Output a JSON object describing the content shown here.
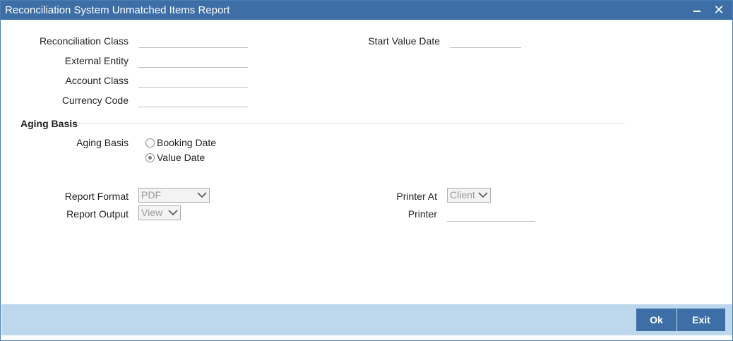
{
  "window": {
    "title": "Reconciliation System Unmatched Items Report"
  },
  "fields": {
    "reconciliation_class": {
      "label": "Reconciliation Class",
      "value": ""
    },
    "external_entity": {
      "label": "External Entity",
      "value": ""
    },
    "account_class": {
      "label": "Account Class",
      "value": ""
    },
    "currency_code": {
      "label": "Currency Code",
      "value": ""
    },
    "start_value_date": {
      "label": "Start Value Date",
      "value": ""
    }
  },
  "aging": {
    "section_title": "Aging Basis",
    "label": "Aging Basis",
    "options": [
      {
        "label": "Booking Date",
        "selected": false
      },
      {
        "label": "Value Date",
        "selected": true
      }
    ]
  },
  "report": {
    "format_label": "Report Format",
    "format_value": "PDF",
    "output_label": "Report Output",
    "output_value": "View",
    "printer_at_label": "Printer At",
    "printer_at_value": "Client",
    "printer_label": "Printer",
    "printer_value": ""
  },
  "buttons": {
    "ok": "Ok",
    "exit": "Exit"
  },
  "colors": {
    "titlebar": "#3d6fa6",
    "footer": "#bdd7ec",
    "button": "#3d6fa6"
  }
}
